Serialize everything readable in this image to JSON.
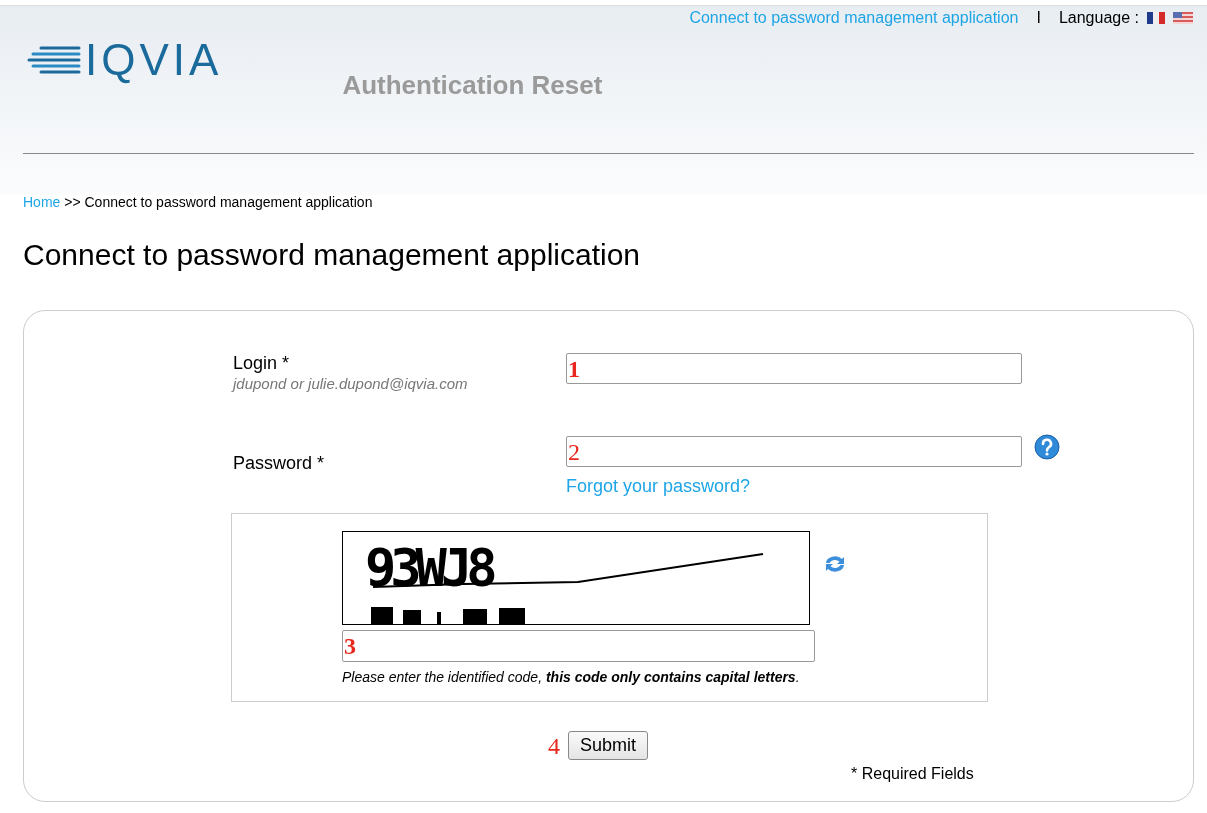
{
  "header": {
    "logo_text": "IQVIA",
    "top_link": "Connect to password management application",
    "separator": "I",
    "language_label": "Language :",
    "title": "Authentication Reset"
  },
  "breadcrumb": {
    "home": "Home",
    "current": ">> Connect to password management application"
  },
  "page_title": "Connect to password management application",
  "form": {
    "fields": [
      {
        "kind": "text",
        "label": "Login *",
        "hint": "jdupond or julie.dupond@iqvia.com",
        "annotation": "1"
      },
      {
        "kind": "password",
        "label": "Password *",
        "annotation": "2",
        "link": "Forgot your password?"
      }
    ],
    "captcha": {
      "code": "93WJ8",
      "annotation": "3",
      "note": "Please enter the identified code, **this code only contains capital letters**."
    },
    "submit": {
      "label": "Submit",
      "annotation": "4"
    },
    "required_note": "* Required Fields"
  }
}
